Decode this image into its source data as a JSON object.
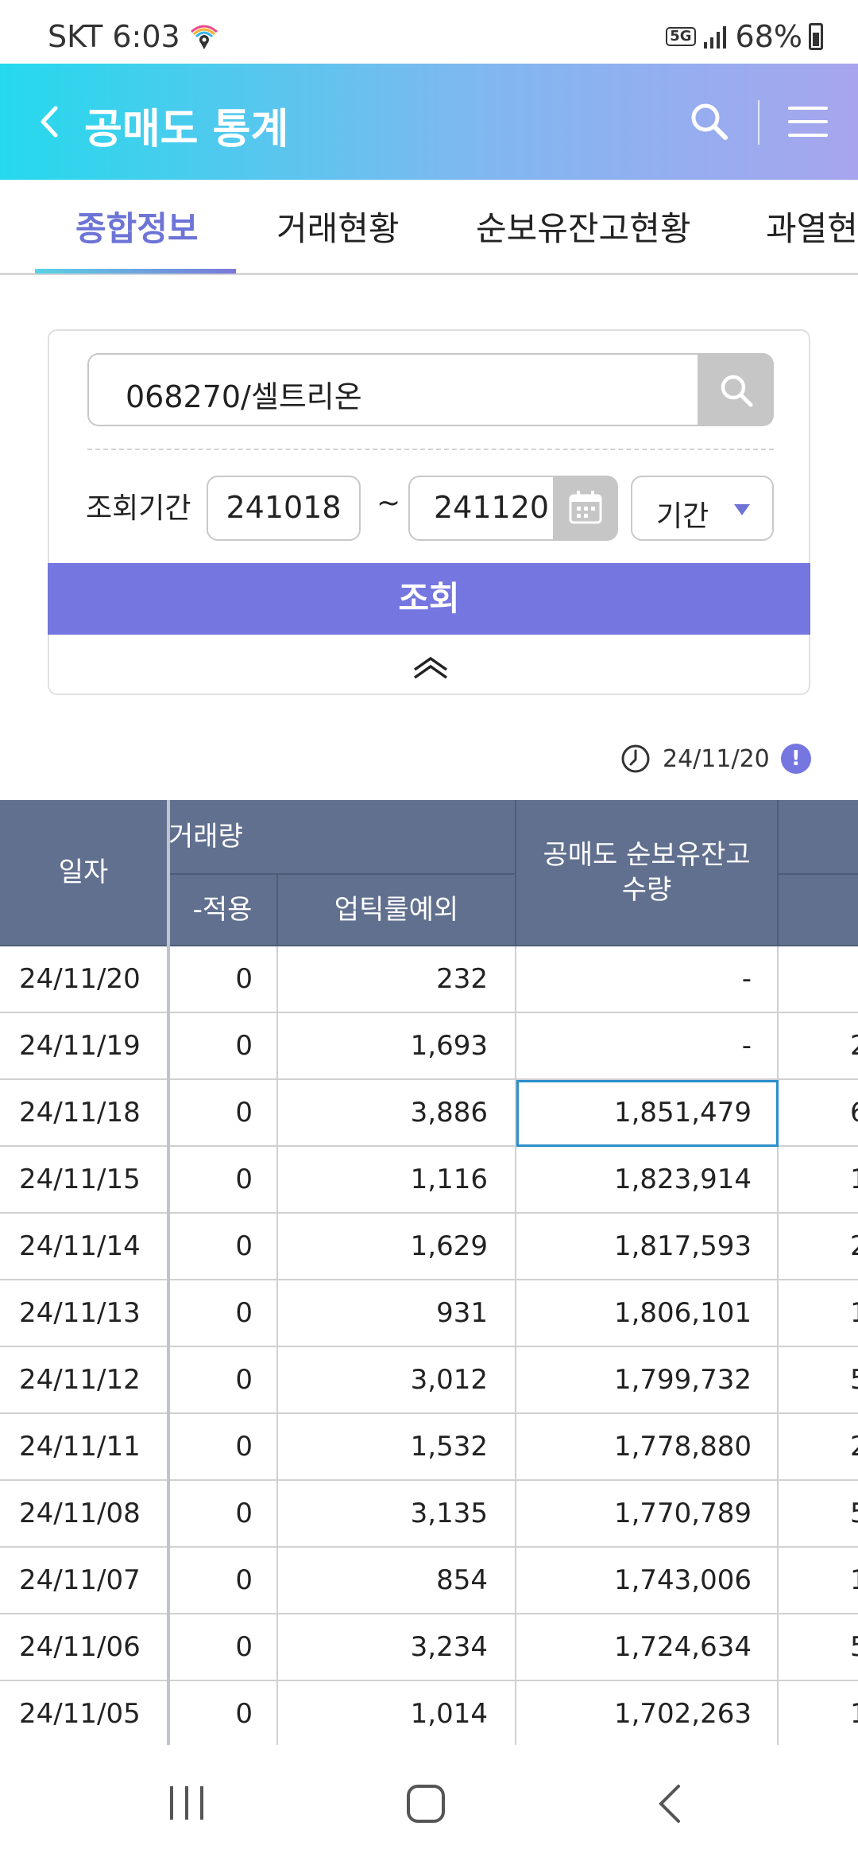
{
  "status_bar": {
    "carrier_time": "SKT 6:03",
    "network": "5G",
    "battery": "68%"
  },
  "header": {
    "title": "공매도 통계"
  },
  "tabs": [
    {
      "label": "종합정보",
      "active": true
    },
    {
      "label": "거래현황",
      "active": false
    },
    {
      "label": "순보유잔고현황",
      "active": false
    },
    {
      "label": "과열현황",
      "active": false
    }
  ],
  "search": {
    "stock_value": "068270/셀트리온",
    "period_label": "조회기간",
    "start_date": "241018",
    "tilde": "~",
    "end_date": "241120",
    "period_type": "기간",
    "query_button": "조회"
  },
  "as_of": {
    "date": "24/11/20",
    "info": "!"
  },
  "table": {
    "headers": {
      "date": "일자",
      "volume_group": "거래량",
      "sub_a": "-적용",
      "sub_b": "업틱룰예외",
      "balance": "공매도 순보유잔고 수량"
    },
    "rows": [
      {
        "date": "24/11/20",
        "a": "0",
        "b": "232",
        "c": "-",
        "d": ""
      },
      {
        "date": "24/11/19",
        "a": "0",
        "b": "1,693",
        "c": "-",
        "d": "2"
      },
      {
        "date": "24/11/18",
        "a": "0",
        "b": "3,886",
        "c": "1,851,479",
        "d": "6"
      },
      {
        "date": "24/11/15",
        "a": "0",
        "b": "1,116",
        "c": "1,823,914",
        "d": "1"
      },
      {
        "date": "24/11/14",
        "a": "0",
        "b": "1,629",
        "c": "1,817,593",
        "d": "2"
      },
      {
        "date": "24/11/13",
        "a": "0",
        "b": "931",
        "c": "1,806,101",
        "d": "1"
      },
      {
        "date": "24/11/12",
        "a": "0",
        "b": "3,012",
        "c": "1,799,732",
        "d": "5"
      },
      {
        "date": "24/11/11",
        "a": "0",
        "b": "1,532",
        "c": "1,778,880",
        "d": "2"
      },
      {
        "date": "24/11/08",
        "a": "0",
        "b": "3,135",
        "c": "1,770,789",
        "d": "5"
      },
      {
        "date": "24/11/07",
        "a": "0",
        "b": "854",
        "c": "1,743,006",
        "d": "1"
      },
      {
        "date": "24/11/06",
        "a": "0",
        "b": "3,234",
        "c": "1,724,634",
        "d": "5"
      },
      {
        "date": "24/11/05",
        "a": "0",
        "b": "1,014",
        "c": "1,702,263",
        "d": "1"
      }
    ],
    "selected_row": 2
  },
  "colors": {
    "accent": "#7576e0",
    "header_gradient_start": "#25d9ec",
    "header_gradient_end": "#a7a5ee",
    "table_header": "#62708f"
  },
  "icons": {
    "back": "chevron-left-icon",
    "search": "search-icon",
    "menu": "hamburger-menu-icon",
    "calendar": "calendar-icon",
    "collapse": "double-chevron-up-icon",
    "clock": "clock-icon"
  }
}
